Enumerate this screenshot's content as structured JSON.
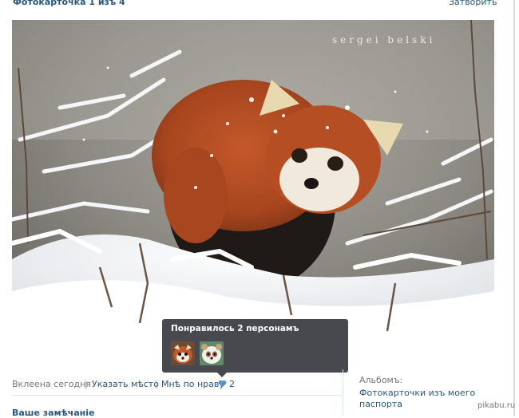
{
  "header": {
    "title": "Фотокарточка 1 изъ 4",
    "close_label": "Затворить"
  },
  "photo": {
    "watermark": "sergei belski",
    "subject": "red panda in snow"
  },
  "likes_tooltip": {
    "title": "Понравилось 2 персонамъ",
    "likers": [
      {
        "avatar": "red-panda-avatar"
      },
      {
        "avatar": "panda-avatar"
      }
    ]
  },
  "meta": {
    "posted": "Вклеена сегодня",
    "separator": "|",
    "report_label": "Указать мѣсто",
    "like_label": "Мнѣ по нраву",
    "like_icon": "heart-icon",
    "like_count": "2"
  },
  "album": {
    "label": "Альбомъ:",
    "name": "Фотокарточки изъ моего паспорта"
  },
  "comments": {
    "label": "Ваше замѣчаніе"
  },
  "watermark_site": "pikabu.ru",
  "colors": {
    "link": "#2b587a",
    "muted": "#777777",
    "tooltip_bg": "#373a40",
    "heart": "#5f90c2"
  }
}
